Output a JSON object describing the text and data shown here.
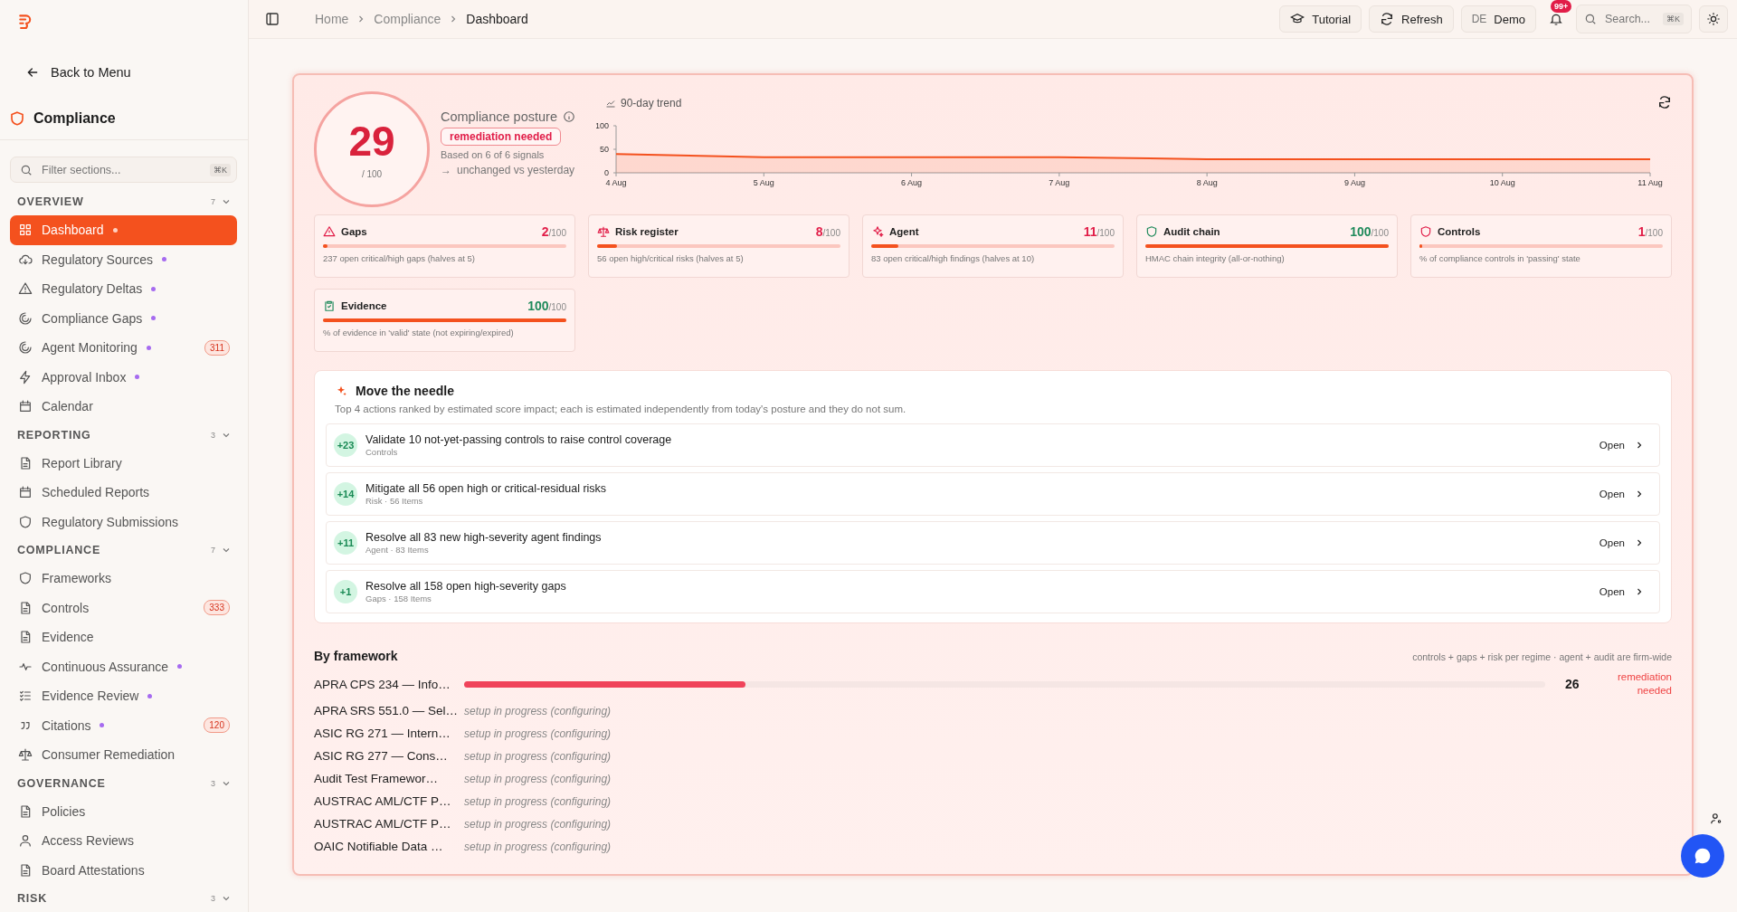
{
  "sidebar": {
    "back": "Back to Menu",
    "title": "Compliance",
    "filter": {
      "placeholder": "Filter sections...",
      "shortcut": "⌘K"
    },
    "groups": [
      {
        "title": "OVERVIEW",
        "count": "7",
        "expanded": true,
        "items": [
          {
            "label": "Dashboard",
            "selected": true,
            "dot": true
          },
          {
            "label": "Regulatory Sources",
            "selected": false,
            "dot": true
          },
          {
            "label": "Regulatory Deltas",
            "selected": false,
            "dot": true
          },
          {
            "label": "Compliance Gaps",
            "selected": false,
            "dot": true
          },
          {
            "label": "Agent Monitoring",
            "selected": false,
            "dot": true,
            "badge": "311"
          },
          {
            "label": "Approval Inbox",
            "selected": false,
            "dot": true
          },
          {
            "label": "Calendar",
            "selected": false,
            "dot": false
          }
        ]
      },
      {
        "title": "REPORTING",
        "count": "3",
        "expanded": true,
        "items": [
          {
            "label": "Report Library",
            "selected": false,
            "dot": false
          },
          {
            "label": "Scheduled Reports",
            "selected": false,
            "dot": false
          },
          {
            "label": "Regulatory Submissions",
            "selected": false,
            "dot": false
          }
        ]
      },
      {
        "title": "COMPLIANCE",
        "count": "7",
        "expanded": true,
        "items": [
          {
            "label": "Frameworks",
            "selected": false,
            "dot": false
          },
          {
            "label": "Controls",
            "selected": false,
            "dot": false,
            "badge": "333"
          },
          {
            "label": "Evidence",
            "selected": false,
            "dot": false
          },
          {
            "label": "Continuous Assurance",
            "selected": false,
            "dot": true
          },
          {
            "label": "Evidence Review",
            "selected": false,
            "dot": true
          },
          {
            "label": "Citations",
            "selected": false,
            "dot": true,
            "badge": "120"
          },
          {
            "label": "Consumer Remediation",
            "selected": false,
            "dot": false
          }
        ]
      },
      {
        "title": "GOVERNANCE",
        "count": "3",
        "expanded": true,
        "items": [
          {
            "label": "Policies",
            "selected": false,
            "dot": false
          },
          {
            "label": "Access Reviews",
            "selected": false,
            "dot": false
          },
          {
            "label": "Board Attestations",
            "selected": false,
            "dot": false
          }
        ]
      },
      {
        "title": "RISK",
        "count": "3",
        "expanded": true
      }
    ]
  },
  "header": {
    "breadcrumbs": [
      "Home",
      "Compliance",
      "Dashboard"
    ],
    "tutorial": "Tutorial",
    "refresh": "Refresh",
    "user_initials": "DE",
    "user": "Demo",
    "notifications": "99+",
    "search": {
      "placeholder": "Search...",
      "shortcut": "⌘K"
    }
  },
  "posture": {
    "score": "29",
    "out_of": "/ 100",
    "title": "Compliance posture",
    "status": "remediation needed",
    "signals": "Based on 6 of 6 signals",
    "change_icon": "→",
    "change": "unchanged vs yesterday",
    "trend_title": "90-day trend",
    "chart_data": {
      "type": "area",
      "categories": [
        "4 Aug",
        "5 Aug",
        "6 Aug",
        "7 Aug",
        "8 Aug",
        "9 Aug",
        "10 Aug",
        "11 Aug"
      ],
      "series": [
        {
          "color": "#f4511e",
          "values": [
            40,
            33,
            33,
            33,
            29,
            29,
            29,
            29
          ]
        }
      ],
      "ylim": [
        0,
        100
      ],
      "yticks": [
        0,
        50,
        100
      ]
    }
  },
  "scores": [
    {
      "title": "Gaps",
      "value": "2",
      "max": "/100",
      "level": 0.02,
      "color": "#e11d48",
      "description": "237 open critical/high gaps (halves at 5)"
    },
    {
      "title": "Risk register",
      "value": "8",
      "max": "/100",
      "level": 0.08,
      "color": "#e11d48",
      "description": "56 open high/critical risks (halves at 5)"
    },
    {
      "title": "Agent",
      "value": "11",
      "max": "/100",
      "level": 0.11,
      "color": "#e11d48",
      "description": "83 open critical/high findings (halves at 10)"
    },
    {
      "title": "Audit chain",
      "value": "100",
      "max": "/100",
      "level": 1,
      "color": "#1f8a5b",
      "description": "HMAC chain integrity (all-or-nothing)"
    },
    {
      "title": "Controls",
      "value": "1",
      "max": "/100",
      "level": 0.01,
      "color": "#e11d48",
      "description": "% of compliance controls in 'passing' state"
    },
    {
      "title": "Evidence",
      "value": "100",
      "max": "/100",
      "level": 1,
      "color": "#1f8a5b",
      "description": "% of evidence in 'valid' state (not expiring/expired)"
    }
  ],
  "needle": {
    "title": "Move the needle",
    "subtitle": "Top 4 actions ranked by estimated score impact; each is estimated independently from today's posture and they do not sum.",
    "actions": [
      {
        "impact": "+23",
        "title": "Validate 10 not-yet-passing controls to raise control coverage",
        "meta": "Controls",
        "button": "Open"
      },
      {
        "impact": "+14",
        "title": "Mitigate all 56 open high or critical-residual risks",
        "meta": "Risk · 56 Items",
        "button": "Open"
      },
      {
        "impact": "+11",
        "title": "Resolve all 83 new high-severity agent findings",
        "meta": "Agent · 83 Items",
        "button": "Open"
      },
      {
        "impact": "+1",
        "title": "Resolve all 158 open high-severity gaps",
        "meta": "Gaps · 158 Items",
        "button": "Open"
      }
    ]
  },
  "frameworks": {
    "title": "By framework",
    "note": "controls + gaps + risk per regime · agent + audit are firm-wide",
    "rows": [
      {
        "kind": "scored",
        "name": "APRA CPS 234 — Info…",
        "level": 0.26,
        "score": "26",
        "status": "remediation needed"
      },
      {
        "kind": "setup",
        "name": "APRA SRS 551.0 — Sel…",
        "status": "setup in progress (configuring)"
      },
      {
        "kind": "setup",
        "name": "ASIC RG 271 — Intern…",
        "status": "setup in progress (configuring)"
      },
      {
        "kind": "setup",
        "name": "ASIC RG 277 — Cons…",
        "status": "setup in progress (configuring)"
      },
      {
        "kind": "setup",
        "name": "Audit Test Framewor…",
        "status": "setup in progress (configuring)"
      },
      {
        "kind": "setup",
        "name": "AUSTRAC AML/CTF P…",
        "status": "setup in progress (configuring)"
      },
      {
        "kind": "setup",
        "name": "AUSTRAC AML/CTF P…",
        "status": "setup in progress (configuring)"
      },
      {
        "kind": "setup",
        "name": "OAIC Notifiable Data …",
        "status": "setup in progress (configuring)"
      }
    ]
  }
}
